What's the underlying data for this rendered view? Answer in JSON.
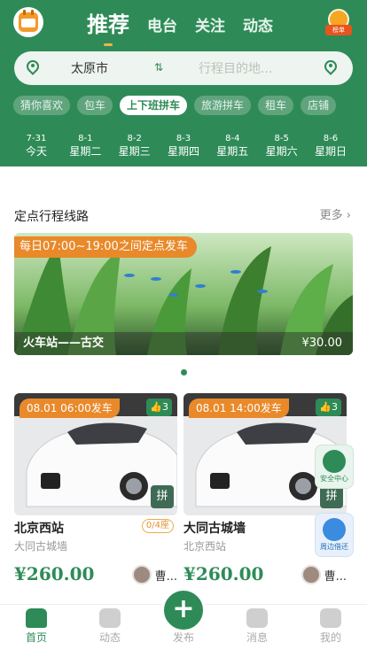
{
  "header": {
    "nav_tabs": [
      {
        "label": "推荐",
        "active": true
      },
      {
        "label": "电台",
        "active": false
      },
      {
        "label": "关注",
        "active": false
      },
      {
        "label": "动态",
        "active": false
      }
    ],
    "logo_icon": "calendar-icon",
    "badge_icon": "medal-icon",
    "badge_text": "榜单"
  },
  "route": {
    "from_city": "太原市",
    "to_placeholder": "行程目的地...",
    "swap_icon": "swap-icon"
  },
  "chips": [
    {
      "label": "猜你喜欢",
      "active": false
    },
    {
      "label": "包车",
      "active": false
    },
    {
      "label": "上下班拼车",
      "active": true
    },
    {
      "label": "旅游拼车",
      "active": false
    },
    {
      "label": "租车",
      "active": false
    },
    {
      "label": "店铺",
      "active": false
    }
  ],
  "dates": [
    {
      "md": "7-31",
      "wd": "今天"
    },
    {
      "md": "8-1",
      "wd": "星期二"
    },
    {
      "md": "8-2",
      "wd": "星期三"
    },
    {
      "md": "8-3",
      "wd": "星期四"
    },
    {
      "md": "8-4",
      "wd": "星期五"
    },
    {
      "md": "8-5",
      "wd": "星期六"
    },
    {
      "md": "8-6",
      "wd": "星期日"
    }
  ],
  "section": {
    "title": "定点行程线路",
    "more": "更多 ›"
  },
  "banner": {
    "tag": "每日07:00~19:00之间定点发车",
    "route": "火车站——古交",
    "price": "¥30.00"
  },
  "cards": [
    {
      "tag": "08.01 06:00发车",
      "likes": "👍3",
      "from": "北京西站",
      "seats": "0/4座",
      "to": "大同古城墙",
      "price": "¥260.00",
      "driver": "曹...",
      "pin": "拼"
    },
    {
      "tag": "08.01 14:00发车",
      "likes": "👍3",
      "from": "大同古城墙",
      "seats": "",
      "to": "北京西站",
      "price": "¥260.00",
      "driver": "曹...",
      "pin": "拼"
    }
  ],
  "floating": {
    "safety": "安全中心",
    "nearby": "周边借还"
  },
  "tabbar": [
    {
      "label": "首页",
      "icon": "home-icon",
      "active": true
    },
    {
      "label": "动态",
      "icon": "fire-icon",
      "active": false
    },
    {
      "label": "发布",
      "icon": "plus-icon",
      "active": false
    },
    {
      "label": "消息",
      "icon": "chat-icon",
      "active": false
    },
    {
      "label": "我的",
      "icon": "user-icon",
      "active": false
    }
  ],
  "colors": {
    "primary": "#2e8b57",
    "accent": "#e9892a"
  }
}
